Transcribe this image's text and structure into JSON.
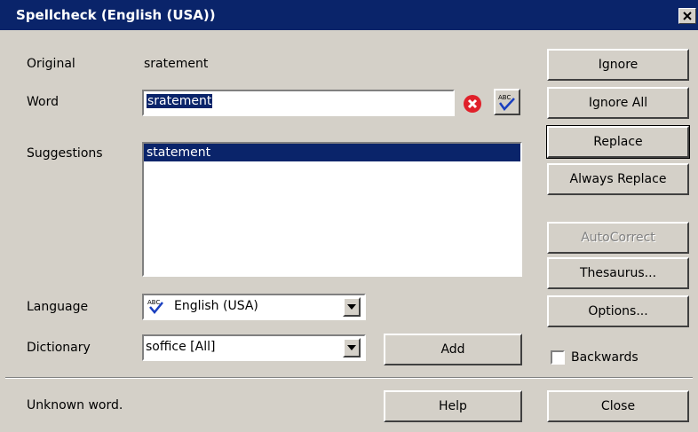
{
  "window": {
    "title": "Spellcheck (English (USA))"
  },
  "fields": {
    "original_label": "Original",
    "original_value": "sratement",
    "word_label": "Word",
    "word_value": "sratement",
    "suggestions_label": "Suggestions",
    "suggestions": [
      "statement"
    ],
    "language_label": "Language",
    "language_value": "English (USA)",
    "dictionary_label": "Dictionary",
    "dictionary_value": "soffice [All]"
  },
  "buttons": {
    "ignore": "Ignore",
    "ignore_all": "Ignore All",
    "replace": "Replace",
    "always_replace": "Always Replace",
    "autocorrect": "AutoCorrect",
    "thesaurus": "Thesaurus...",
    "options": "Options...",
    "add": "Add",
    "help": "Help",
    "close": "Close"
  },
  "backwards": {
    "label": "Backwards",
    "checked": false
  },
  "status": "Unknown word.",
  "icons": [
    "close-icon",
    "clear-icon",
    "spellcheck-icon",
    "language-icon",
    "dropdown-arrow-icon"
  ],
  "colors": {
    "title_bg": "#0a246a",
    "window_bg": "#d4d0c8",
    "clear_icon": "#e0202a"
  }
}
